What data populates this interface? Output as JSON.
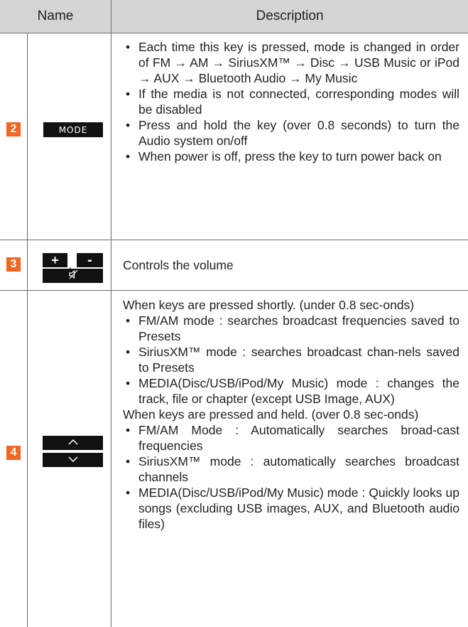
{
  "header": {
    "name": "Name",
    "description": "Description"
  },
  "rows": [
    {
      "number": "2",
      "key_label": "MODE",
      "items": [
        {
          "type": "bullet",
          "text": "Each time this key is pressed, mode is changed in order of FM → AM → SiriusXM™ → Disc → USB Music or iPod → AUX → Bluetooth Audio → My Music"
        },
        {
          "type": "bullet",
          "text": "If the media is not connected, corresponding modes will be disabled"
        },
        {
          "type": "bullet",
          "text": "Press and hold the key (over 0.8 seconds) to turn the Audio system on/off"
        },
        {
          "type": "bullet",
          "text": "When power is off, press the key to turn power back on"
        }
      ]
    },
    {
      "number": "3",
      "keys": {
        "plus": "+",
        "comma": ",",
        "minus": "-",
        "mute_icon": "mute-icon"
      },
      "items": [
        {
          "type": "plain",
          "text": "Controls the volume"
        }
      ]
    },
    {
      "number": "4",
      "keys": {
        "up_icon": "chevron-up-icon",
        "down_icon": "chevron-down-icon"
      },
      "items": [
        {
          "type": "plain",
          "text": "When keys are pressed shortly. (under 0.8 sec-onds)"
        },
        {
          "type": "bullet",
          "text": "FM/AM mode : searches broadcast frequencies saved to Presets"
        },
        {
          "type": "bullet",
          "text": "SiriusXM™ mode : searches broadcast chan-nels saved to Presets"
        },
        {
          "type": "bullet",
          "text": "MEDIA(Disc/USB/iPod/My Music) mode : changes the track, file or chapter (except USB Image, AUX)"
        },
        {
          "type": "plain",
          "text": "When keys are pressed and held. (over 0.8 sec-onds)"
        },
        {
          "type": "bullet",
          "text": "FM/AM Mode : Automatically searches broad-cast frequencies"
        },
        {
          "type": "bullet",
          "text": "SiriusXM™ mode : automatically searches broadcast channels"
        },
        {
          "type": "bullet",
          "text": "MEDIA(Disc/USB/iPod/My Music) mode : Quickly looks up songs (excluding USB images, AUX, and Bluetooth audio files)"
        }
      ]
    }
  ],
  "colors": {
    "number_badge": "#f26522",
    "header_bg": "#d5d5d5",
    "key_bg": "#111111"
  }
}
